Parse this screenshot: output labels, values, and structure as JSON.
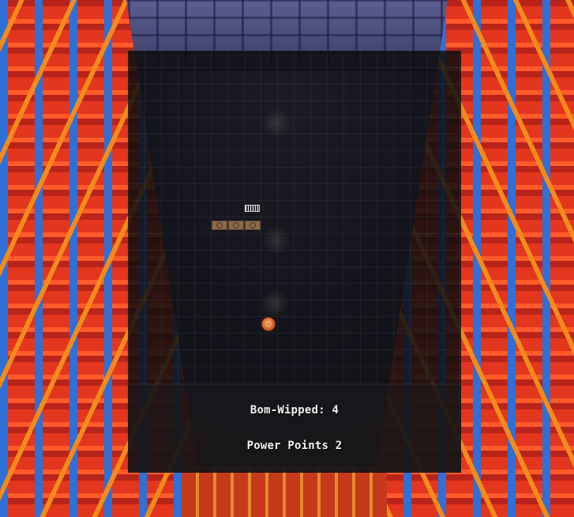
{
  "hud": {
    "bomb_wipped_label": "Bom-Wipped: 4",
    "power_points_label": "Power Points 2"
  },
  "game": {
    "bricks": [
      {
        "color": "#8b6a4a"
      },
      {
        "color": "#8b6a4a"
      },
      {
        "color": "#8b6a4a"
      }
    ],
    "ball_color": "#d8672a",
    "powerup_icon": "striped-powerup-icon"
  },
  "colors": {
    "panel_bg": "#0e0e10",
    "hud_text": "#f2f2f2",
    "rack_red": "#e2361e",
    "rack_blue": "#2f6fd6",
    "rack_orange": "#f28b1c"
  }
}
